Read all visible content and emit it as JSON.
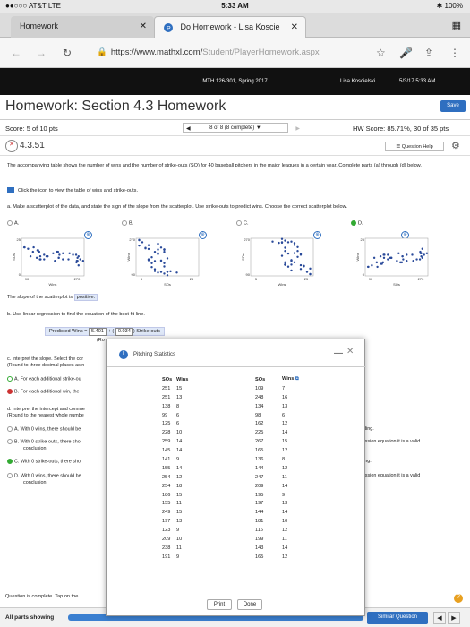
{
  "status": {
    "carrier": "●●○○○ AT&T  LTE",
    "time": "5:33 AM",
    "battery": "✱ 100%"
  },
  "tabs": [
    {
      "label": "Homework",
      "close": "✕"
    },
    {
      "label": "Do Homework - Lisa Koscie",
      "close": "✕"
    }
  ],
  "url": {
    "host": "https://www.mathxl.com/",
    "path": "Student/PlayerHomework.aspx"
  },
  "course": {
    "title": "MTH 126-301, Spring 2017",
    "user": "Lisa Koscielski",
    "datetime": "5/3/17 5:33 AM"
  },
  "header": {
    "title": "Homework: Section 4.3 Homework",
    "save": "Save"
  },
  "score": {
    "score": "Score: 5 of 10 pts",
    "pager": "8 of 8 (8 complete) ▼",
    "hw_score": "HW Score: 85.71%, 30 of 35 pts"
  },
  "question": {
    "number": "4.3.51",
    "help": "Question Help"
  },
  "intro": "The accompanying table shows the number of wins and the number of strike-outs (SO) for 40 baseball pitchers in the major leagues in a certain year. Complete parts (a) through (d) below.",
  "table_link": "Click the icon to view the table of wins and strike-outs.",
  "part_a": "a. Make a scatterplot of the data, and state the sign of the slope from the scatterplot. Use strike-outs to predict wins. Choose the correct scatterplot below.",
  "options": [
    {
      "label": "A.",
      "ymax": "25",
      "ymin": "0",
      "xmin": "90",
      "xmax": "270",
      "xlabel": "Wins",
      "ylabel": "SOs"
    },
    {
      "label": "B.",
      "ymax": "270",
      "ymin": "90",
      "xmin": "5",
      "xmax": "25",
      "xlabel": "SOs",
      "ylabel": "Wins"
    },
    {
      "label": "C.",
      "ymax": "270",
      "ymin": "90",
      "xmin": "5",
      "xmax": "25",
      "xlabel": "Wins",
      "ylabel": "SOs"
    },
    {
      "label": "D.",
      "ymax": "25",
      "ymin": "0",
      "xmin": "90",
      "xmax": "270",
      "xlabel": "SOs",
      "ylabel": "Wins"
    }
  ],
  "slope_text": "The slope of the scatterplot is",
  "slope_answer": "positive.",
  "part_b": "b. Use linear regression to find the equation of the best-fit line.",
  "predicted": {
    "label": "Predicted Wins =",
    "intercept": "5.401",
    "plus": "+",
    "slope": "0.034",
    "var": "Strike-outs",
    "rounding": "(Ro"
  },
  "part_c": {
    "line1": "c. Interpret the slope. Select the cor",
    "line2": "(Round to three decimal places as n",
    "optA": "A.  For each additional strike-ou",
    "optB": "B.  For each additional win, the"
  },
  "part_d": {
    "line1": "d. Interpret the intercept and comme",
    "line2": "(Round to the nearest whole numbe",
    "optA": "A.  With 0 wins, there should be",
    "optA_r": "eading.",
    "optB": "B.  With 0 strike-outs, there sho",
    "optB_r": "gression equation it is a valid",
    "optB_c": "conclusion.",
    "optC": "C.  With 0 strike-outs, there sho",
    "optC_r": "ading.",
    "optD": "D.  With 0 wins, there should be",
    "optD_r": "gression equation it is a valid",
    "optD_c": "conclusion."
  },
  "footer": {
    "complete": "Question is complete. Tap on the",
    "all_parts": "All parts showing",
    "progress": 1.0,
    "similar": "Similar Question",
    "prev": "◀",
    "next": "▶"
  },
  "popup": {
    "title": "Pitching Statistics",
    "minimize": "—",
    "close": "✕",
    "headers": [
      "SOs",
      "Wins",
      "SOs",
      "Wins"
    ],
    "rows": [
      [
        "251",
        "15",
        "109",
        "7"
      ],
      [
        "251",
        "13",
        "248",
        "16"
      ],
      [
        "138",
        "8",
        "134",
        "13"
      ],
      [
        "99",
        "6",
        "98",
        "6"
      ],
      [
        "125",
        "6",
        "162",
        "12"
      ],
      [
        "228",
        "10",
        "225",
        "14"
      ],
      [
        "259",
        "14",
        "267",
        "15"
      ],
      [
        "145",
        "14",
        "165",
        "12"
      ],
      [
        "141",
        "9",
        "136",
        "8"
      ],
      [
        "155",
        "14",
        "144",
        "12"
      ],
      [
        "254",
        "12",
        "247",
        "11"
      ],
      [
        "254",
        "18",
        "209",
        "14"
      ],
      [
        "186",
        "15",
        "195",
        "9"
      ],
      [
        "155",
        "11",
        "197",
        "13"
      ],
      [
        "249",
        "15",
        "144",
        "14"
      ],
      [
        "197",
        "13",
        "181",
        "10"
      ],
      [
        "123",
        "9",
        "116",
        "12"
      ],
      [
        "209",
        "10",
        "199",
        "11"
      ],
      [
        "238",
        "11",
        "143",
        "14"
      ],
      [
        "191",
        "9",
        "165",
        "12"
      ]
    ],
    "print": "Print",
    "done": "Done"
  },
  "colors": {
    "accent": "#2f6fc0",
    "dots": "#2a4a9a",
    "answer_bg": "#dfe8f8"
  }
}
